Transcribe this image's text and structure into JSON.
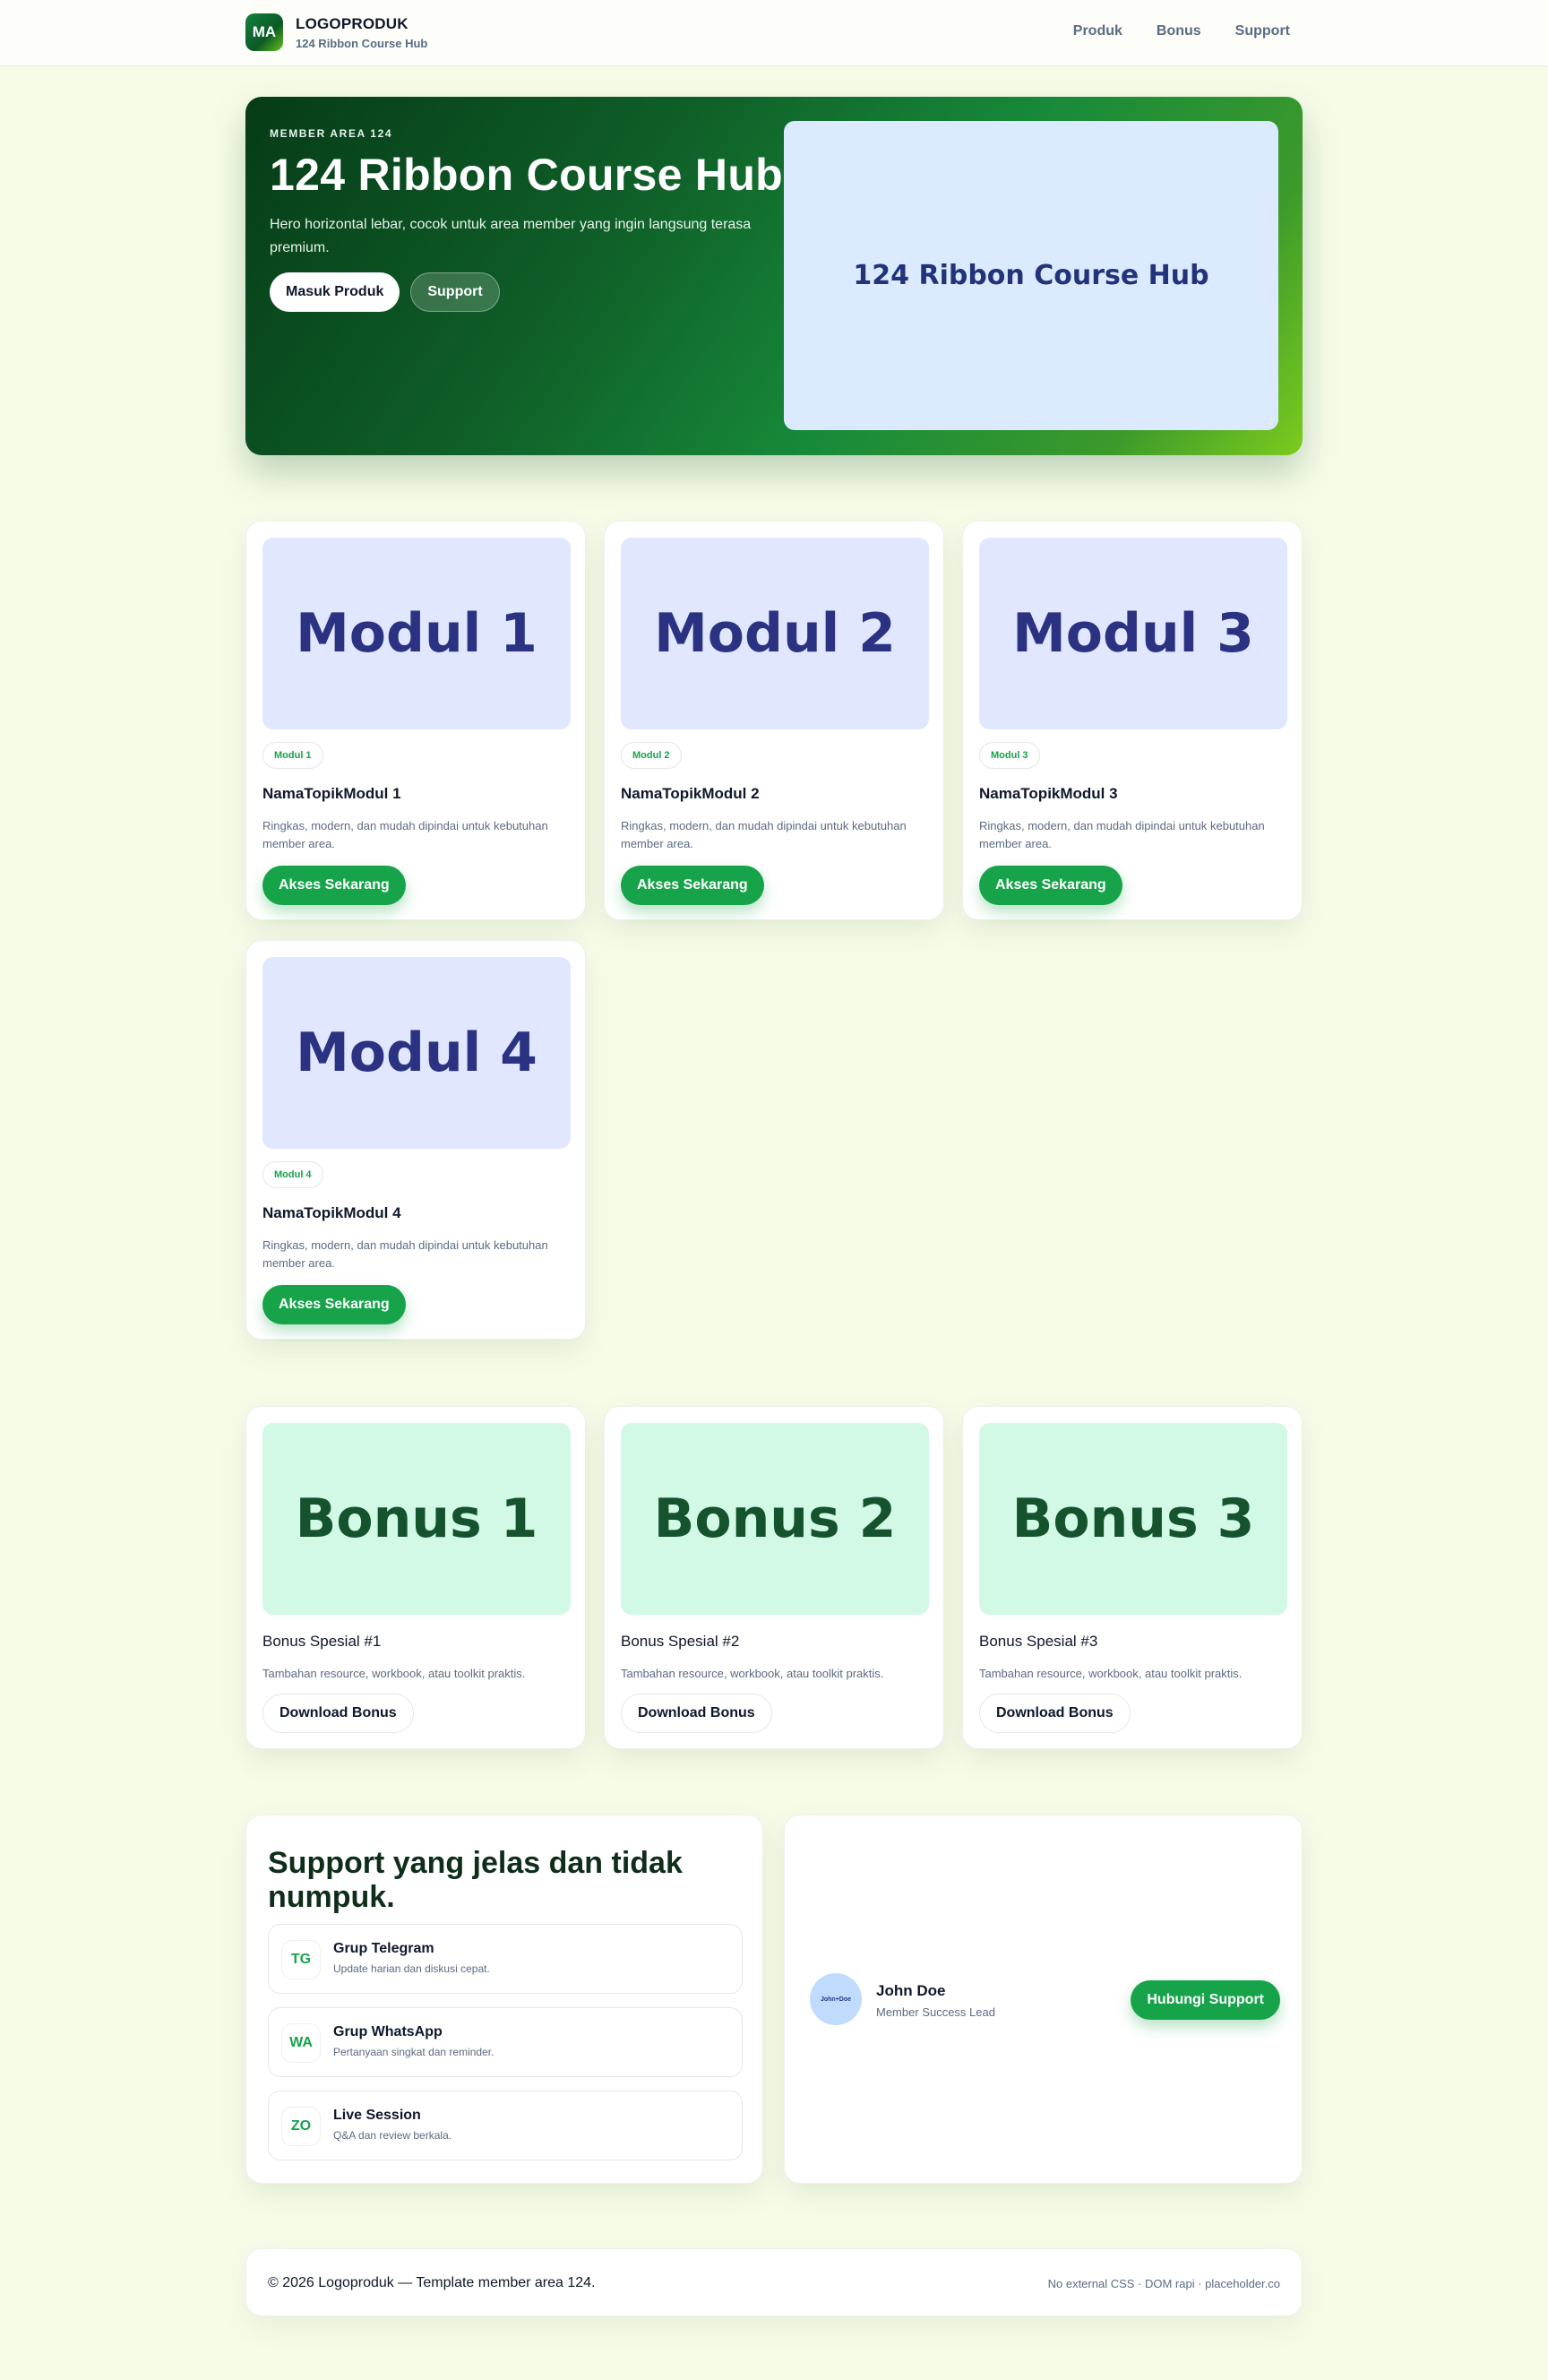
{
  "header": {
    "logo_initials": "MA",
    "brand_name": "LOGOPRODUK",
    "brand_sub": "124 Ribbon Course Hub",
    "nav": [
      "Produk",
      "Bonus",
      "Support"
    ]
  },
  "hero": {
    "kicker": "MEMBER AREA 124",
    "title": "124 Ribbon Course Hub",
    "description": "Hero horizontal lebar, cocok untuk area member yang ingin langsung terasa premium.",
    "primary_button": "Masuk Produk",
    "secondary_button": "Support",
    "image_label": "124 Ribbon Course Hub"
  },
  "modules": [
    {
      "thumb": "Modul 1",
      "pill": "Modul 1",
      "title": "NamaTopikModul 1",
      "desc": "Ringkas, modern, dan mudah dipindai untuk kebutuhan member area.",
      "button": "Akses Sekarang"
    },
    {
      "thumb": "Modul 2",
      "pill": "Modul 2",
      "title": "NamaTopikModul 2",
      "desc": "Ringkas, modern, dan mudah dipindai untuk kebutuhan member area.",
      "button": "Akses Sekarang"
    },
    {
      "thumb": "Modul 3",
      "pill": "Modul 3",
      "title": "NamaTopikModul 3",
      "desc": "Ringkas, modern, dan mudah dipindai untuk kebutuhan member area.",
      "button": "Akses Sekarang"
    },
    {
      "thumb": "Modul 4",
      "pill": "Modul 4",
      "title": "NamaTopikModul 4",
      "desc": "Ringkas, modern, dan mudah dipindai untuk kebutuhan member area.",
      "button": "Akses Sekarang"
    }
  ],
  "bonuses": [
    {
      "thumb": "Bonus 1",
      "title": "Bonus Spesial #1",
      "desc": "Tambahan resource, workbook, atau toolkit praktis.",
      "button": "Download Bonus"
    },
    {
      "thumb": "Bonus 2",
      "title": "Bonus Spesial #2",
      "desc": "Tambahan resource, workbook, atau toolkit praktis.",
      "button": "Download Bonus"
    },
    {
      "thumb": "Bonus 3",
      "title": "Bonus Spesial #3",
      "desc": "Tambahan resource, workbook, atau toolkit praktis.",
      "button": "Download Bonus"
    }
  ],
  "support": {
    "title": "Support yang jelas dan tidak numpuk.",
    "channels": [
      {
        "icon": "TG",
        "name": "Grup Telegram",
        "desc": "Update harian dan diskusi cepat."
      },
      {
        "icon": "WA",
        "name": "Grup WhatsApp",
        "desc": "Pertanyaan singkat dan reminder."
      },
      {
        "icon": "ZO",
        "name": "Live Session",
        "desc": "Q&A dan review berkala."
      }
    ]
  },
  "contact": {
    "avatar_label": "John+Doe",
    "name": "John Doe",
    "role": "Member Success Lead",
    "button": "Hubungi Support"
  },
  "footer": {
    "left": "© 2026 Logoproduk — Template member area 124.",
    "right": "No external CSS · DOM rapi · placeholder.co"
  },
  "colors": {
    "page_bg": "#f7fce9",
    "accent_green": "#16a34a",
    "hero_dark": "#063b18",
    "hero_light": "#7ccb1e",
    "module_thumb_bg": "#e0e7fe",
    "bonus_thumb_bg": "#d2f8e6"
  }
}
